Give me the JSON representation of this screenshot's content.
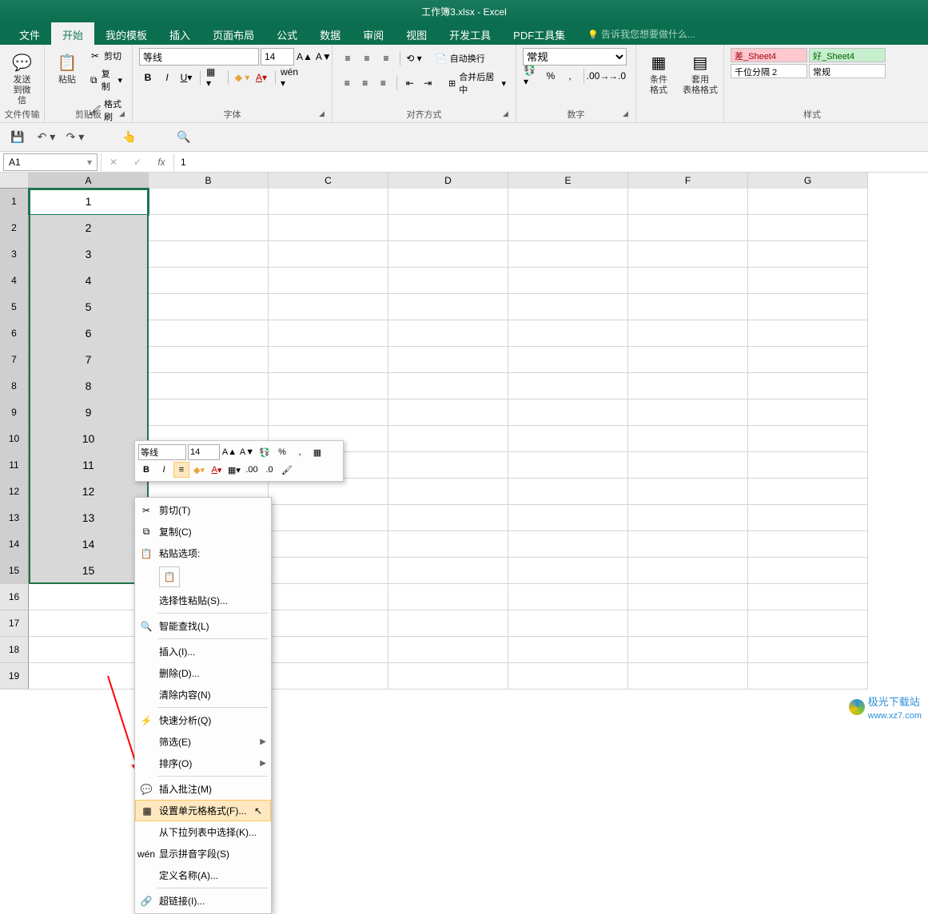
{
  "title": {
    "filename": "工作簿3.xlsx",
    "app": "Excel",
    "sep": " - "
  },
  "tabs": {
    "file": "文件",
    "home": "开始",
    "template": "我的模板",
    "insert": "插入",
    "layout": "页面布局",
    "formulas": "公式",
    "data": "数据",
    "review": "审阅",
    "view": "视图",
    "dev": "开发工具",
    "pdf": "PDF工具集",
    "tellme": "告诉我您想要做什么..."
  },
  "ribbon": {
    "filetrans": {
      "send": "发送",
      "wechat": "到微信",
      "label": "文件传输"
    },
    "clipboard": {
      "paste": "粘贴",
      "cut": "剪切",
      "copy": "复制",
      "format_painter": "格式刷",
      "label": "剪贴板"
    },
    "font": {
      "name": "等线",
      "size": "14",
      "label": "字体"
    },
    "align": {
      "wrap": "自动换行",
      "merge": "合并后居中",
      "label": "对齐方式"
    },
    "number": {
      "general": "常规",
      "label": "数字"
    },
    "styles": {
      "cond": "条件格式",
      "table": "套用\n表格格式",
      "bad": "差_Sheet4",
      "good": "好_Sheet4",
      "thousand": "千位分隔 2",
      "normal": "常规",
      "label": "样式"
    }
  },
  "namebox": "A1",
  "formula": "1",
  "columns": [
    "A",
    "B",
    "C",
    "D",
    "E",
    "F",
    "G"
  ],
  "rows": [
    "1",
    "2",
    "3",
    "4",
    "5",
    "6",
    "7",
    "8",
    "9",
    "10",
    "11",
    "12",
    "13",
    "14",
    "15",
    "16",
    "17",
    "18",
    "19"
  ],
  "cell_values": [
    "1",
    "2",
    "3",
    "4",
    "5",
    "6",
    "7",
    "8",
    "9",
    "10",
    "11",
    "12",
    "13",
    "14",
    "15"
  ],
  "mini": {
    "font": "等线",
    "size": "14"
  },
  "ctx": {
    "cut": "剪切(T)",
    "copy": "复制(C)",
    "paste_opts": "粘贴选项:",
    "paste_special": "选择性粘贴(S)...",
    "smart_lookup": "智能查找(L)",
    "insert": "插入(I)...",
    "delete": "删除(D)...",
    "clear": "清除内容(N)",
    "quick_analysis": "快速分析(Q)",
    "filter": "筛选(E)",
    "sort": "排序(O)",
    "comment": "插入批注(M)",
    "format_cells": "设置单元格格式(F)...",
    "dropdown": "从下拉列表中选择(K)...",
    "pinyin": "显示拼音字段(S)",
    "define_name": "定义名称(A)...",
    "hyperlink": "超链接(I)..."
  },
  "watermark": {
    "site": "极光下载站",
    "url": "www.xz7.com"
  }
}
